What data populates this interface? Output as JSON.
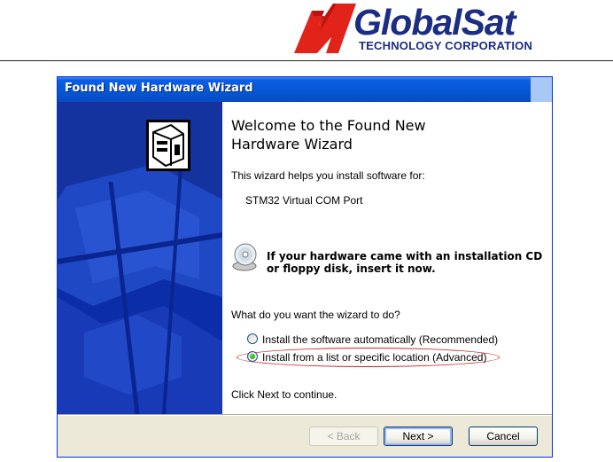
{
  "header": {
    "brand_name": "GlobalSat",
    "brand_subtitle": "TECHNOLOGY CORPORATION",
    "logo_color": "#1c2d84",
    "mark_color": "#e2231a"
  },
  "wizard": {
    "title": "Found New Hardware Wizard",
    "welcome_title": "Welcome to the Found New Hardware Wizard",
    "intro": "This wizard helps you install software for:",
    "device": "STM32 Virtual COM Port",
    "cd_prompt_line1": "If your hardware came with an installation CD",
    "cd_prompt_line2": "or floppy disk, insert it now.",
    "question": "What do you want the wizard to do?",
    "options": [
      {
        "label": "Install the software automatically (Recommended)",
        "selected": false
      },
      {
        "label": "Install from a list or specific location (Advanced)",
        "selected": true
      }
    ],
    "continue_hint": "Click Next to continue.",
    "buttons": {
      "back": "< Back",
      "next": "Next >",
      "cancel": "Cancel"
    },
    "back_enabled": false,
    "highlight_color": "#d02020"
  }
}
